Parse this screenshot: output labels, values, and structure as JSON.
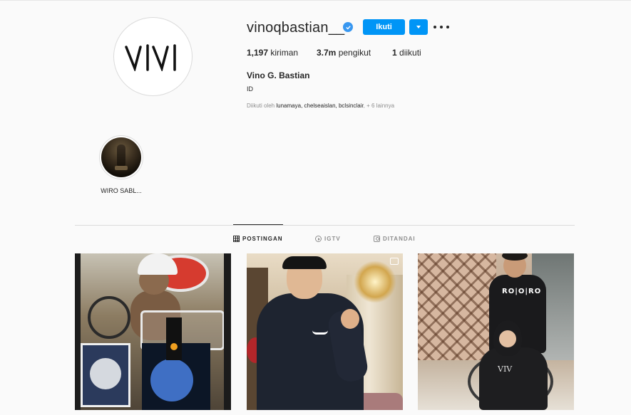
{
  "profile": {
    "username": "vinoqbastian__",
    "verified": true,
    "follow_label": "Ikuti",
    "stats": {
      "posts_count": "1,197",
      "posts_label": "kiriman",
      "followers_count": "3.7m",
      "followers_label": "pengikut",
      "following_count": "1",
      "following_label": "diikuti"
    },
    "full_name": "Vino G. Bastian",
    "bio": "ID",
    "followed_by_prefix": "Diikuti oleh",
    "followed_by_names": "lunamaya, chelseaislan, bclsinclair",
    "followed_by_suffix": ", + 6 lainnya"
  },
  "highlights": [
    {
      "label": "WIRO SABL..."
    }
  ],
  "tabs": [
    {
      "label": "POSTINGAN",
      "icon": "grid-icon",
      "active": true
    },
    {
      "label": "IGTV",
      "icon": "igtv-icon",
      "active": false
    },
    {
      "label": "DITANDAI",
      "icon": "tagged-icon",
      "active": false
    }
  ],
  "posts": [
    {
      "id": 1,
      "badge": "none"
    },
    {
      "id": 2,
      "badge": "carousel-icon"
    },
    {
      "id": 3,
      "badge": "none",
      "shirt_text": "RO|O|RO"
    }
  ],
  "colors": {
    "accent": "#0095f6",
    "verified": "#3897f0",
    "text": "#262626",
    "muted": "#8e8e8e",
    "background": "#fafafa"
  }
}
